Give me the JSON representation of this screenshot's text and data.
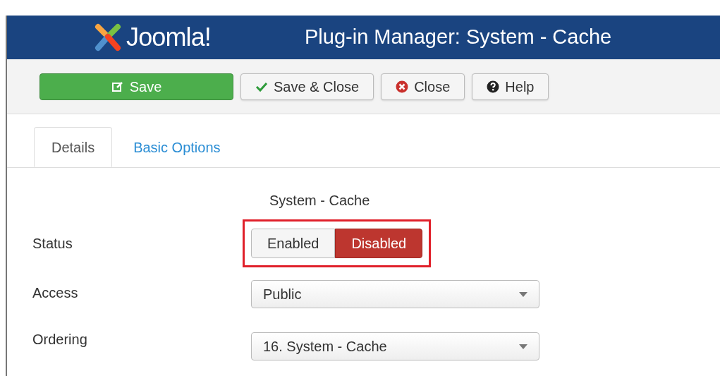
{
  "header": {
    "logo": "Joomla!",
    "title": "Plug-in Manager: System - Cache"
  },
  "toolbar": [
    {
      "kind": "save",
      "label": "Save"
    },
    {
      "kind": "apply",
      "label": "Save & Close"
    },
    {
      "kind": "cancel",
      "label": "Close"
    },
    {
      "kind": "help",
      "label": "Help"
    }
  ],
  "tabs": [
    {
      "label": "Details",
      "selected": true
    },
    {
      "label": "Basic Options",
      "selected": false
    }
  ],
  "plugin_name": "System - Cache",
  "fields": [
    {
      "kind": "toggle",
      "label": "Status",
      "highlighted": true,
      "options": [
        {
          "label": "Enabled",
          "selected": false
        },
        {
          "label": "Disabled",
          "selected": true
        }
      ]
    },
    {
      "kind": "select",
      "label": "Access",
      "value": "Public"
    },
    {
      "kind": "select",
      "label": "Ordering",
      "value": "16. System - Cache"
    }
  ]
}
